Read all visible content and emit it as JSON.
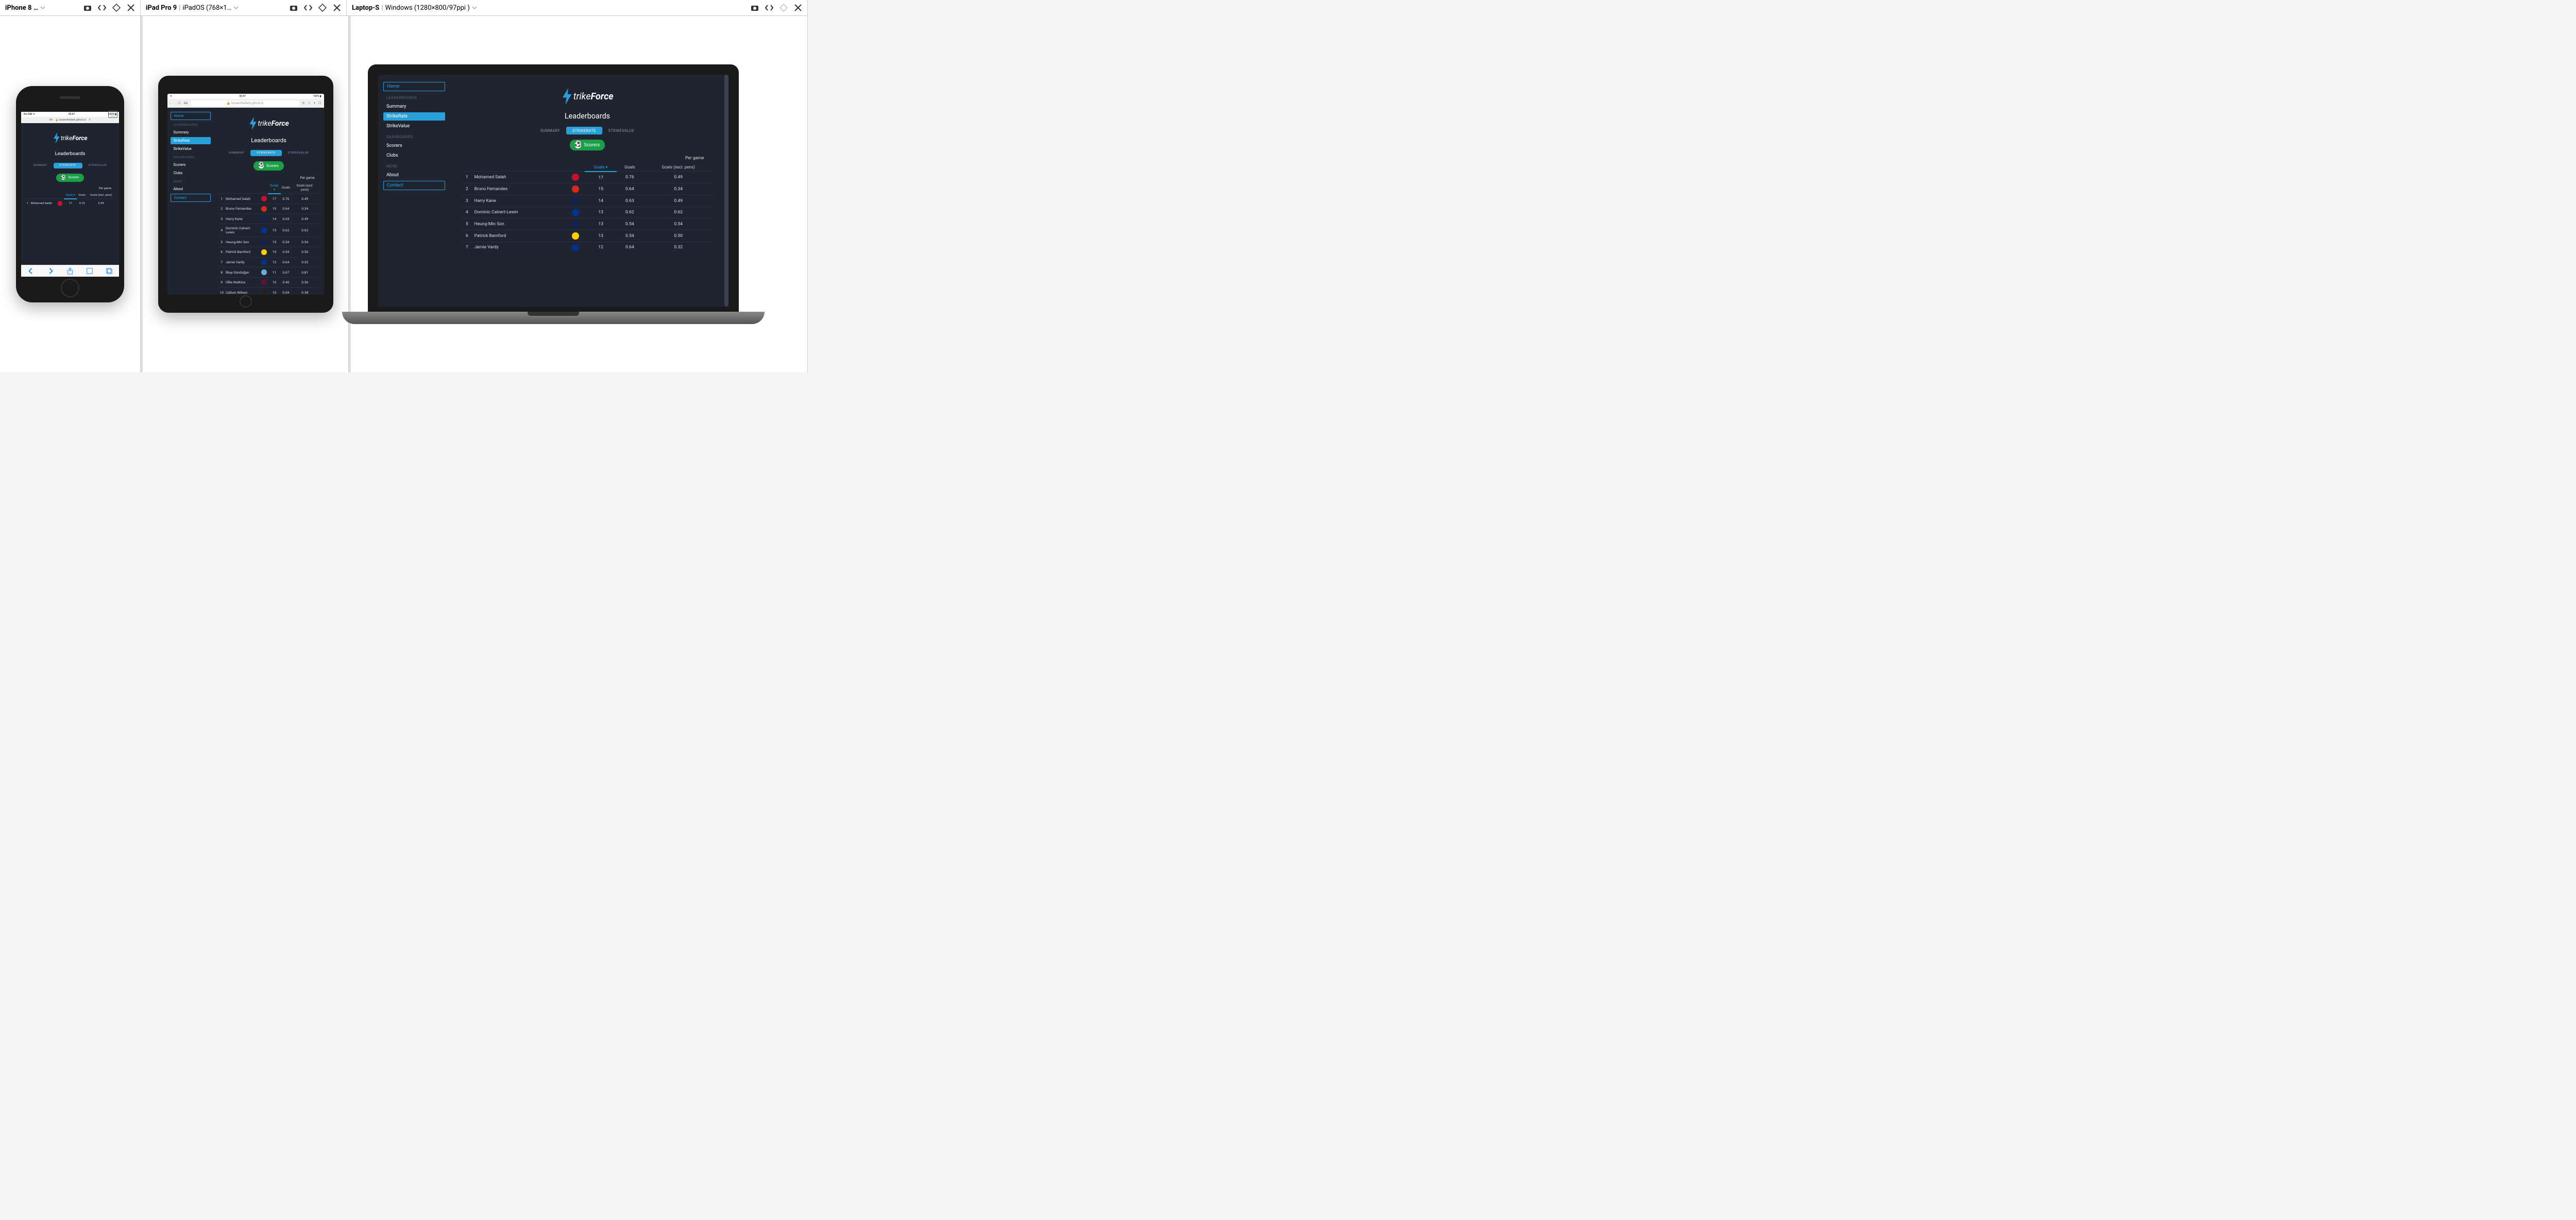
{
  "panels": [
    {
      "name": "iPhone 8 …",
      "details": ""
    },
    {
      "name": "iPad Pro 9",
      "details": "iPadOS (768×1…"
    },
    {
      "name": "Laptop-S",
      "details": "Windows (1280×800/97ppi )"
    }
  ],
  "ios_status": {
    "left": "No SIM ᯤ",
    "center": "00:47",
    "right": "100% ▮"
  },
  "ios_status_tablet": {
    "left": "ᯤ",
    "center": "00:47",
    "right": "100% ▮"
  },
  "ios_url": "loosenthedark.github.io",
  "app": {
    "logo_a": "trike",
    "logo_b": "Force",
    "sidebar": {
      "home": "Home",
      "sec1": "LEADERBOARDS",
      "summary": "Summary",
      "strikerate": "StrikeRate",
      "strikevalue": "StrikeValue",
      "sec2": "DASHBOARDS",
      "scorers": "Scorers",
      "clubs": "Clubs",
      "sec3": "MORE",
      "about": "About",
      "contact": "Contact"
    },
    "page_title": "Leaderboards",
    "tabs": {
      "summary": "SUMMARY",
      "strikerate": "STRIKERATE",
      "strikevalue": "STRIKEVALUE"
    },
    "scorers_btn": "Scorers",
    "table": {
      "per_game": "Per game",
      "headers": {
        "goals": "Goals",
        "goals2": "Goals",
        "excl": "Goals (excl. pens)"
      },
      "rows": [
        {
          "rank": "1",
          "name": "Mohamed Salah",
          "crest": "#C8102E",
          "goals": "17",
          "pg": "0.76",
          "expg": "0.49"
        },
        {
          "rank": "2",
          "name": "Bruno Fernandes",
          "crest": "#DA291C",
          "goals": "15",
          "pg": "0.64",
          "expg": "0.34"
        },
        {
          "rank": "3",
          "name": "Harry Kane",
          "crest": "#132257",
          "goals": "14",
          "pg": "0.63",
          "expg": "0.49"
        },
        {
          "rank": "4",
          "name": "Dominic Calvert-Lewin",
          "crest": "#003399",
          "goals": "13",
          "pg": "0.62",
          "expg": "0.62"
        },
        {
          "rank": "5",
          "name": "Heung-Min Son",
          "crest": "#132257",
          "goals": "13",
          "pg": "0.54",
          "expg": "0.54"
        },
        {
          "rank": "6",
          "name": "Patrick Bamford",
          "crest": "#FFCD00",
          "goals": "13",
          "pg": "0.54",
          "expg": "0.50"
        },
        {
          "rank": "7",
          "name": "Jamie Vardy",
          "crest": "#003090",
          "goals": "12",
          "pg": "0.64",
          "expg": "0.32"
        },
        {
          "rank": "8",
          "name": "İlkay Gündoğan",
          "crest": "#6CABDD",
          "goals": "11",
          "pg": "0.67",
          "expg": "0.81"
        },
        {
          "rank": "9",
          "name": "Ollie Watkins",
          "crest": "#670E36",
          "goals": "10",
          "pg": "0.40",
          "expg": "0.36"
        },
        {
          "rank": "10",
          "name": "Callum Wilson",
          "crest": "#241F20",
          "goals": "10",
          "pg": "0.54",
          "expg": "0.38"
        }
      ]
    }
  }
}
